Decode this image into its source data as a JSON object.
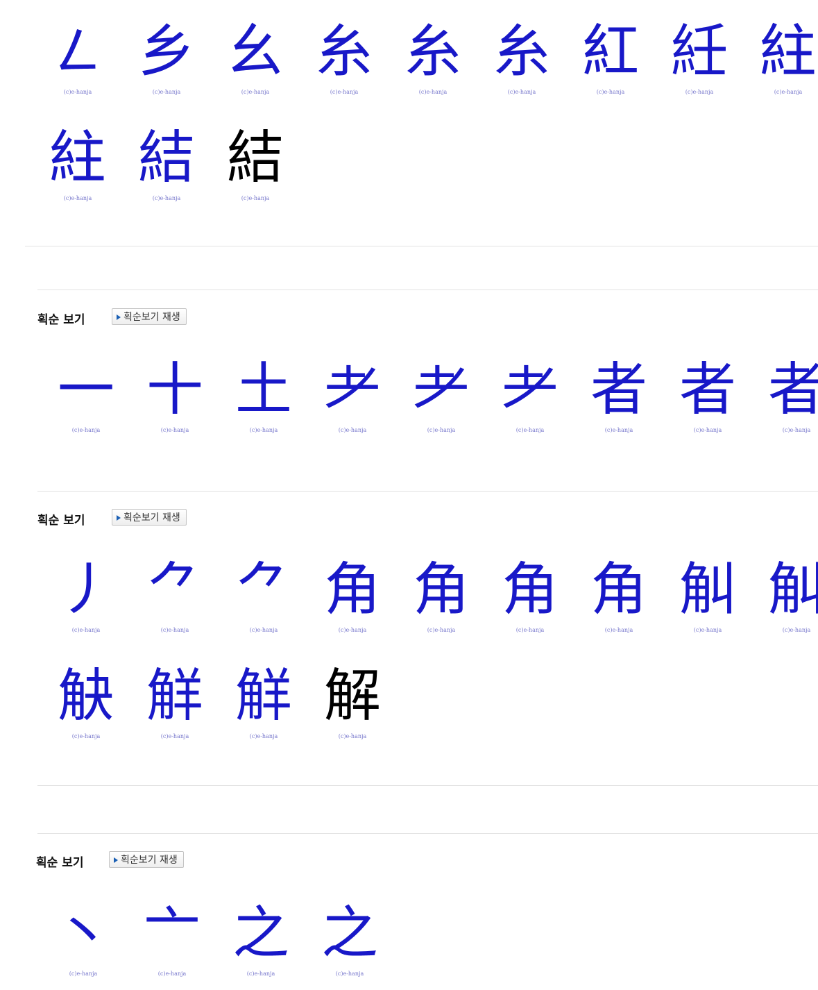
{
  "credit_text": "(c)e-hanja",
  "sections": [
    {
      "char": "結",
      "heading": null,
      "button": null,
      "frames": [
        "㇜",
        "乡",
        "幺",
        "糸",
        "糸",
        "糸",
        "紅",
        "紝",
        "紸",
        "紸",
        "結",
        "結"
      ],
      "final_index": 11
    },
    {
      "char": "者",
      "heading": "획순 보기",
      "button": "획순보기 재생",
      "frames": [
        "一",
        "十",
        "土",
        "耂",
        "耂",
        "耂",
        "者",
        "者",
        "者"
      ],
      "final_index": null
    },
    {
      "char": "解",
      "heading": "획순 보기",
      "button": "획순보기 재생",
      "frames": [
        "丿",
        "⺈",
        "⺈",
        "角",
        "角",
        "角",
        "角",
        "觓",
        "觓",
        "觖",
        "觧",
        "觧",
        "解"
      ],
      "final_index": 12
    },
    {
      "char": "之",
      "heading": "획순 보기",
      "button": "획순보기 재생",
      "frames": [
        "丶",
        "亠",
        "之",
        "之"
      ],
      "final_index": null
    }
  ],
  "colors": {
    "stroke_past": "#000000",
    "stroke_current": "#1818c8",
    "credit": "#7777cc"
  }
}
